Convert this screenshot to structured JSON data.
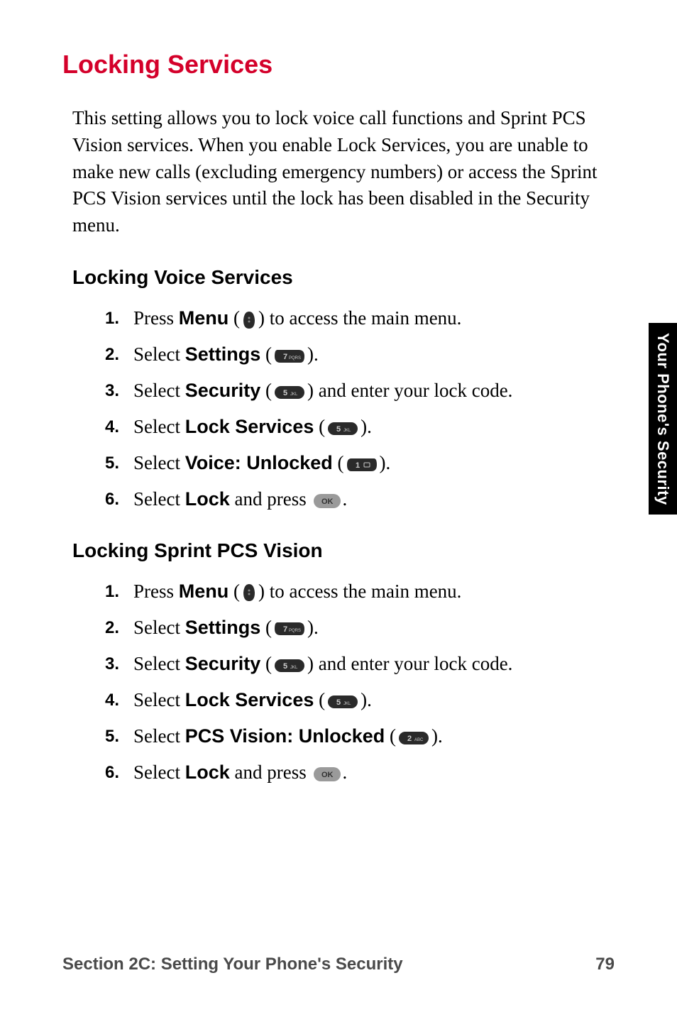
{
  "title": "Locking Services",
  "intro": "This setting allows you to lock voice call functions and Sprint PCS Vision services. When you enable Lock Services, you are unable to make new calls (excluding emergency numbers) or access the Sprint PCS Vision services until the lock has been disabled in the Security menu.",
  "section_voice": {
    "heading": "Locking Voice Services",
    "steps": [
      {
        "n": "1.",
        "pre": "Press ",
        "bold": "Menu",
        "post": " to access the main menu.",
        "icon": "nav"
      },
      {
        "n": "2.",
        "pre": "Select ",
        "bold": "Settings",
        "post": ".",
        "icon": "7"
      },
      {
        "n": "3.",
        "pre": "Select ",
        "bold": "Security",
        "post": " and enter your lock code.",
        "icon": "5"
      },
      {
        "n": "4.",
        "pre": "Select ",
        "bold": "Lock Services",
        "post": ".",
        "icon": "5"
      },
      {
        "n": "5.",
        "pre": "Select ",
        "bold": "Voice: Unlocked",
        "post": ".",
        "icon": "1"
      },
      {
        "n": "6.",
        "pre": "Select ",
        "bold": "Lock",
        "mid": " and press ",
        "post": ".",
        "icon": "ok"
      }
    ]
  },
  "section_vision": {
    "heading": "Locking Sprint PCS Vision",
    "steps": [
      {
        "n": "1.",
        "pre": "Press ",
        "bold": "Menu",
        "post": " to access the main menu.",
        "icon": "nav"
      },
      {
        "n": "2.",
        "pre": "Select ",
        "bold": "Settings",
        "post": ".",
        "icon": "7"
      },
      {
        "n": "3.",
        "pre": "Select ",
        "bold": "Security",
        "post": " and enter your lock code.",
        "icon": "5"
      },
      {
        "n": "4.",
        "pre": "Select ",
        "bold": "Lock Services",
        "post": ".",
        "icon": "5"
      },
      {
        "n": "5.",
        "pre": "Select ",
        "bold": "PCS Vision: Unlocked",
        "post": ".",
        "icon": "2"
      },
      {
        "n": "6.",
        "pre": "Select ",
        "bold": "Lock",
        "mid": " and press ",
        "post": ".",
        "icon": "ok"
      }
    ]
  },
  "side_tab": "Your Phone's Security",
  "footer": {
    "left": "Section 2C: Setting Your Phone's Security",
    "right": "79"
  },
  "icons": {
    "nav": "nav-key-icon",
    "7": "key-7-pqrs",
    "5": "key-5-jkl",
    "1": "key-1",
    "2": "key-2-abc",
    "ok": "ok-key"
  }
}
